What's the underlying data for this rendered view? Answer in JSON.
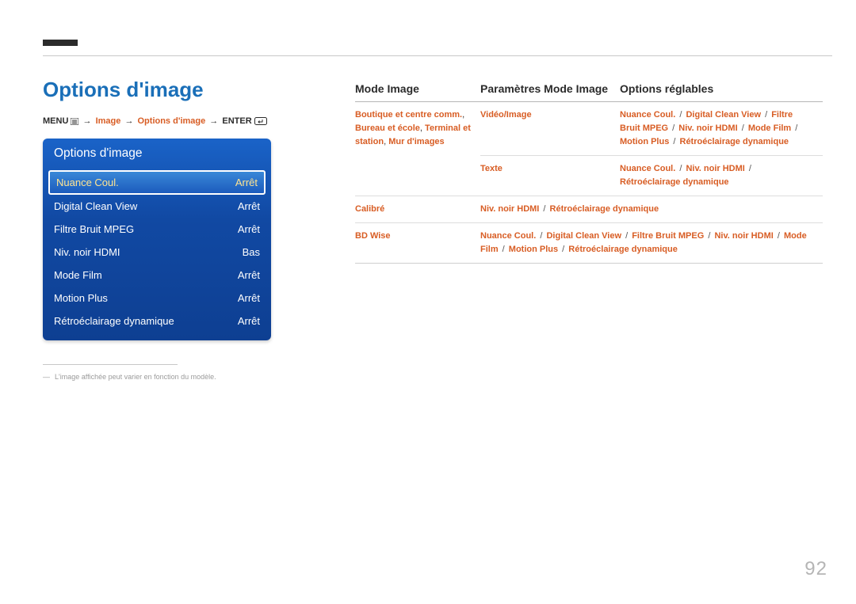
{
  "page": {
    "number": "92",
    "heading": "Options d'image",
    "footnote_dash": "―",
    "footnote": "L'image affichée peut varier en fonction du modèle."
  },
  "breadcrumb": {
    "menu": "MENU",
    "arrow": "→",
    "image": "Image",
    "options": "Options d'image",
    "enter": "ENTER"
  },
  "panel": {
    "title": "Options d'image",
    "rows": [
      {
        "label": "Nuance Coul.",
        "value": "Arrêt"
      },
      {
        "label": "Digital Clean View",
        "value": "Arrêt"
      },
      {
        "label": "Filtre Bruit MPEG",
        "value": "Arrêt"
      },
      {
        "label": "Niv. noir HDMI",
        "value": "Bas"
      },
      {
        "label": "Mode Film",
        "value": "Arrêt"
      },
      {
        "label": "Motion Plus",
        "value": "Arrêt"
      },
      {
        "label": "Rétroéclairage dynamique",
        "value": "Arrêt"
      }
    ]
  },
  "table": {
    "headers": {
      "mode": "Mode Image",
      "params": "Paramètres Mode Image",
      "options": "Options réglables"
    },
    "sep": " / ",
    "comma": ", ",
    "rows": [
      {
        "mode_parts": [
          "Boutique et centre comm.",
          "Bureau et école",
          "Terminal et station",
          "Mur d'images"
        ],
        "params": [
          "Vidéo/Image"
        ],
        "options": [
          "Nuance Coul.",
          "Digital Clean View",
          "Filtre Bruit MPEG",
          "Niv. noir HDMI",
          "Mode Film",
          "Motion Plus",
          "Rétroéclairage dynamique"
        ]
      },
      {
        "mode_parts": [],
        "params": [
          "Texte"
        ],
        "options": [
          "Nuance Coul.",
          "Niv. noir HDMI",
          "Rétroéclairage dynamique"
        ]
      },
      {
        "mode_parts": [
          "Calibré"
        ],
        "params": [],
        "options": [
          "Niv. noir HDMI",
          "Rétroéclairage dynamique"
        ]
      },
      {
        "mode_parts": [
          "BD Wise"
        ],
        "params": [],
        "options": [
          "Nuance Coul.",
          "Digital Clean View",
          "Filtre Bruit MPEG",
          "Niv. noir HDMI",
          "Mode Film",
          "Motion Plus",
          "Rétroéclairage dynamique"
        ]
      }
    ]
  }
}
